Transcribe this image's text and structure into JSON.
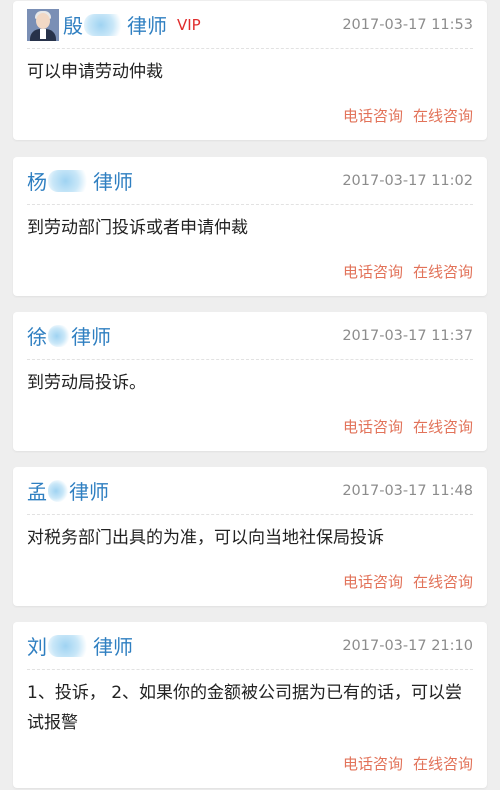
{
  "answers": [
    {
      "name_prefix": "殷",
      "name_suffix": "律师",
      "vip": "VIP",
      "time": "2017-03-17 11:53",
      "content": "可以申请劳动仲裁",
      "phone_label": "电话咨询",
      "online_label": "在线咨询"
    },
    {
      "name_prefix": "杨",
      "name_suffix": "律师",
      "time": "2017-03-17 11:02",
      "content": "到劳动部门投诉或者申请仲裁",
      "phone_label": "电话咨询",
      "online_label": "在线咨询"
    },
    {
      "name_prefix": "徐",
      "name_suffix": "律师",
      "time": "2017-03-17 11:37",
      "content": "到劳动局投诉。",
      "phone_label": "电话咨询",
      "online_label": "在线咨询"
    },
    {
      "name_prefix": "孟",
      "name_suffix": "律师",
      "time": "2017-03-17 11:48",
      "content": "对税务部门出具的为准，可以向当地社保局投诉",
      "phone_label": "电话咨询",
      "online_label": "在线咨询"
    },
    {
      "name_prefix": "刘",
      "name_suffix": "律师",
      "time": "2017-03-17 21:10",
      "content": "1、投诉，  2、如果你的金额被公司据为已有的话，可以尝试报警",
      "phone_label": "电话咨询",
      "online_label": "在线咨询"
    }
  ],
  "colors": {
    "background": "#eeeeee",
    "lawyer_name": "#2f7fc1",
    "vip": "#e02d2d",
    "action": "#e2735a",
    "time": "#8c8c8c"
  }
}
